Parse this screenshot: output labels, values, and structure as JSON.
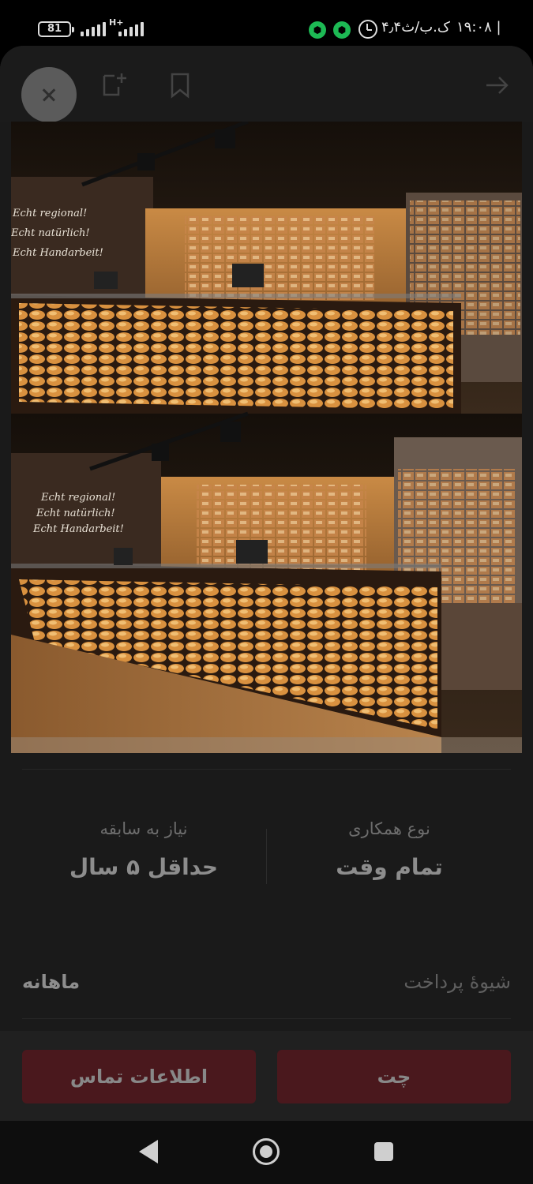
{
  "status_bar": {
    "battery": "81",
    "network": "H+",
    "carrier_text": "۴٫۴ک.ب/ث",
    "time_text": "۱۹:۰۸ |"
  },
  "toolbar": {
    "close": "close-icon",
    "note": "note-add-icon",
    "bookmark": "bookmark-icon",
    "forward": "arrow-forward-icon"
  },
  "photo": {
    "wall_text": [
      "Echt regional!",
      "Echt natürlich!",
      "Echt Handarbeit!"
    ]
  },
  "details": {
    "cooperation_label": "نوع همکاری",
    "cooperation_value": "تمام وقت",
    "experience_label": "نیاز به سابقه",
    "experience_value": "حداقل ۵ سال"
  },
  "payment": {
    "label": "شیوهٔ پرداخت",
    "value": "ماهانه"
  },
  "actions": {
    "chat": "چت",
    "contact": "اطلاعات تماس"
  },
  "colors": {
    "action_button": "#4a181d",
    "sheet_background": "#1a1a1a",
    "badge_green": "#1db954"
  }
}
